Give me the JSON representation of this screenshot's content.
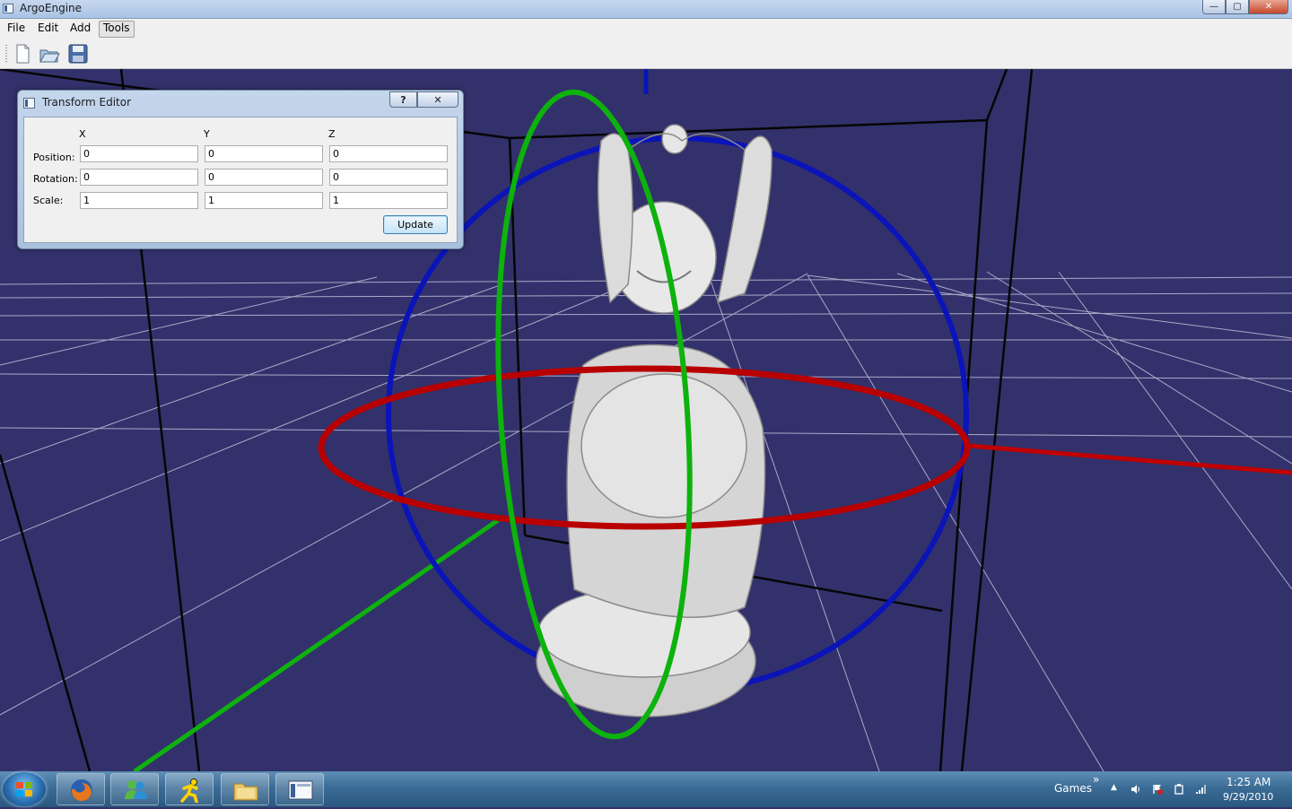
{
  "window": {
    "title": "ArgoEngine",
    "controls": [
      "—",
      "▢",
      "✕"
    ]
  },
  "menu": {
    "items": [
      "File",
      "Edit",
      "Add",
      "Tools"
    ],
    "active": "Tools"
  },
  "toolbar": {
    "buttons": [
      "new-file",
      "open-folder",
      "save-disk"
    ]
  },
  "dialog": {
    "title": "Transform Editor",
    "help_label": "?",
    "close_label": "✕",
    "columns": [
      "X",
      "Y",
      "Z"
    ],
    "rows": [
      {
        "label": "Position:",
        "values": [
          "0",
          "0",
          "0"
        ]
      },
      {
        "label": "Rotation:",
        "values": [
          "0",
          "0",
          "0"
        ]
      },
      {
        "label": "Scale:",
        "values": [
          "1",
          "1",
          "1"
        ]
      }
    ],
    "update_label": "Update"
  },
  "viewport": {
    "background": "#33316b",
    "gizmo_colors": {
      "x": "#c00000",
      "y": "#0db20d",
      "z": "#0a14b8"
    },
    "model": "buddha-statue"
  },
  "taskbar": {
    "apps": [
      "start-orb",
      "firefox",
      "messenger",
      "aim",
      "explorer",
      "argoengine"
    ],
    "toolbar_label": "Games",
    "chevron": "»",
    "clock_time": "1:25 AM",
    "clock_date": "9/29/2010"
  }
}
